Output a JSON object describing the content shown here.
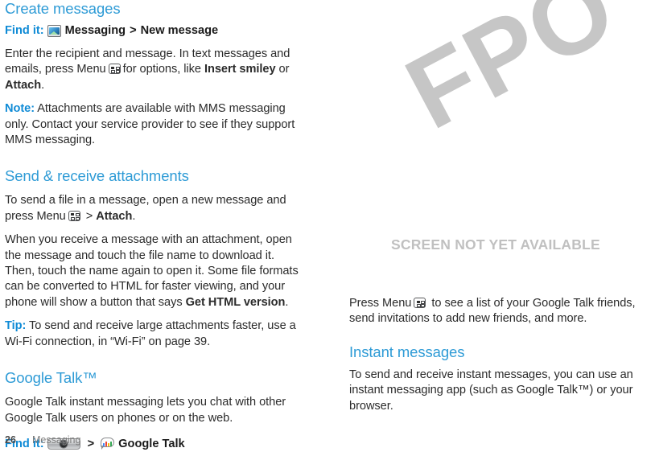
{
  "document": {
    "footer": {
      "page_number": "26",
      "chapter": "Messaging"
    }
  },
  "left_column": {
    "section1": {
      "heading": "Create messages",
      "find_it": {
        "label": "Find it:",
        "app_icon": "messaging-icon",
        "app_name": "Messaging",
        "separator": ">",
        "target": "New message"
      },
      "para1_a": "Enter the recipient and message. In text messages and emails, press Menu",
      "para1_b": "for options, like ",
      "para1_bold1": "Insert smiley",
      "para1_c": " or ",
      "para1_bold2": "Attach",
      "para1_d": ".",
      "note_label": "Note:",
      "note_text": " Attachments are available with MMS messaging only. Contact your service provider to see if they support MMS messaging."
    },
    "section2": {
      "heading": "Send & receive attachments",
      "para1_a": "To send a file in a message, open a new message and press Menu",
      "para1_b": " > ",
      "para1_bold": "Attach",
      "para1_c": ".",
      "para2_a": "When you receive a message with an attachment, open the message and touch the file name to download it. Then, touch the name again to open it. Some file formats can be converted to HTML for faster viewing, and your phone will show a button that says ",
      "para2_bold": "Get HTML version",
      "para2_b": ".",
      "tip_label": "Tip:",
      "tip_text": " To send and receive large attachments faster, use a Wi-Fi connection, in “Wi-Fi” on page 39."
    },
    "section3": {
      "heading": "Google Talk™",
      "para1": "Google Talk instant messaging lets you chat with other Google Talk users on phones or on the web.",
      "find_it": {
        "label": "Find it:",
        "home_icon": "home-key-icon",
        "separator": ">",
        "app_icon": "google-talk-icon",
        "app_name": "Google Talk"
      }
    }
  },
  "right_column": {
    "placeholder": {
      "watermark": "FPO",
      "caption": "SCREEN NOT YET AVAILABLE"
    },
    "para1_a": "Press Menu",
    "para1_b": " to see a list of your Google Talk friends, send invitations to add new friends, and more.",
    "section": {
      "heading": "Instant messages",
      "para1": "To send and receive instant messages, you can use an instant messaging app (such as Google Talk™) or your browser."
    }
  },
  "colors": {
    "heading_blue": "#2e9bd6",
    "label_blue": "#108bd6",
    "body_text": "#2b2b2b",
    "placeholder_gray": "#c6c6c6"
  }
}
